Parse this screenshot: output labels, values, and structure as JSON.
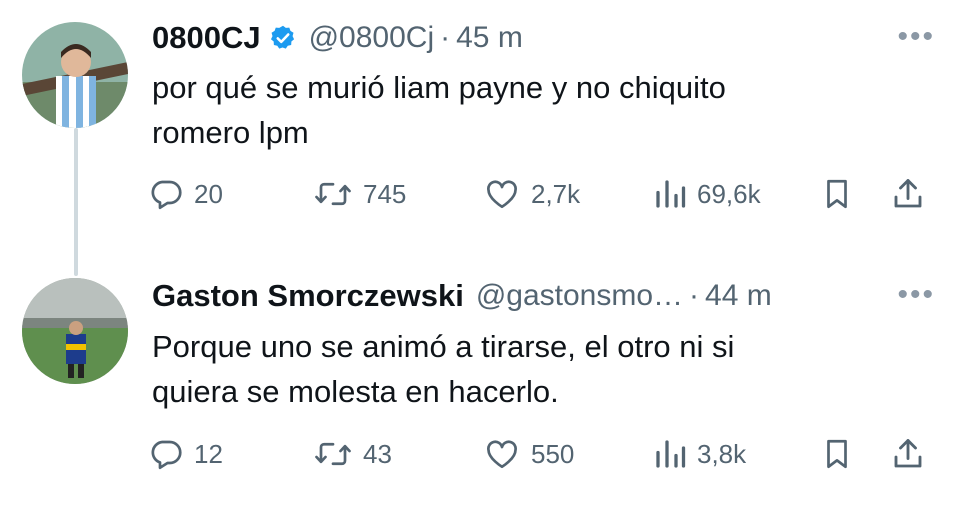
{
  "tweets": [
    {
      "name": "0800CJ",
      "handle": "@0800Cj",
      "time": "45 m",
      "verified": true,
      "text_lines": [
        "por qué se murió liam payne y no chiquito",
        "romero lpm"
      ],
      "stats": {
        "replies": "20",
        "reposts": "745",
        "likes": "2,7k",
        "views": "69,6k"
      }
    },
    {
      "name": "Gaston Smorczewski",
      "handle": "@gastonsmo…",
      "time": "44 m",
      "verified": false,
      "text_lines": [
        "Porque uno se animó a tirarse, el otro ni si",
        "quiera se molesta en hacerlo."
      ],
      "stats": {
        "replies": "12",
        "reposts": "43",
        "likes": "550",
        "views": "3,8k"
      }
    }
  ],
  "ui": {
    "dot": "·",
    "more": "•••"
  },
  "colors": {
    "accent": "#1d9bf0",
    "text": "#0f1419",
    "muted": "#536471",
    "thread_line": "#cfd9de"
  },
  "icons": [
    "verified-badge-icon",
    "reply-icon",
    "repost-icon",
    "like-icon",
    "views-icon",
    "bookmark-icon",
    "share-icon",
    "more-icon"
  ]
}
